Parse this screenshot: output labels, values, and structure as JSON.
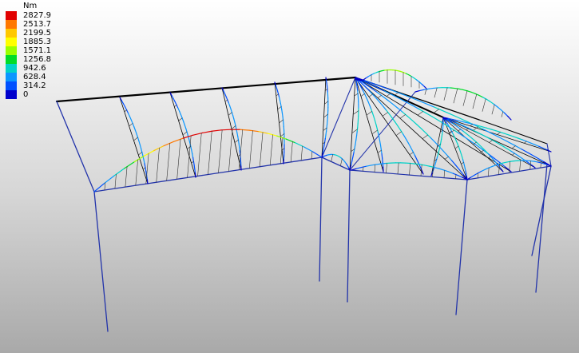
{
  "legend": {
    "unit": "Nm",
    "entries": [
      {
        "label": "2827.9",
        "color": "#e10000"
      },
      {
        "label": "2513.7",
        "color": "#ff7800"
      },
      {
        "label": "2199.5",
        "color": "#ffc800"
      },
      {
        "label": "1885.3",
        "color": "#ffff00"
      },
      {
        "label": "1571.1",
        "color": "#9aff00"
      },
      {
        "label": "1256.8",
        "color": "#00dc28"
      },
      {
        "label": "942.6",
        "color": "#00d2c8"
      },
      {
        "label": "628.4",
        "color": "#0a96ff"
      },
      {
        "label": "314.2",
        "color": "#0050ff"
      },
      {
        "label": "0",
        "color": "#0000cc"
      }
    ]
  },
  "colors": {
    "frame": "#2233aa",
    "ridge": "#000000",
    "hatch": "#333333"
  }
}
